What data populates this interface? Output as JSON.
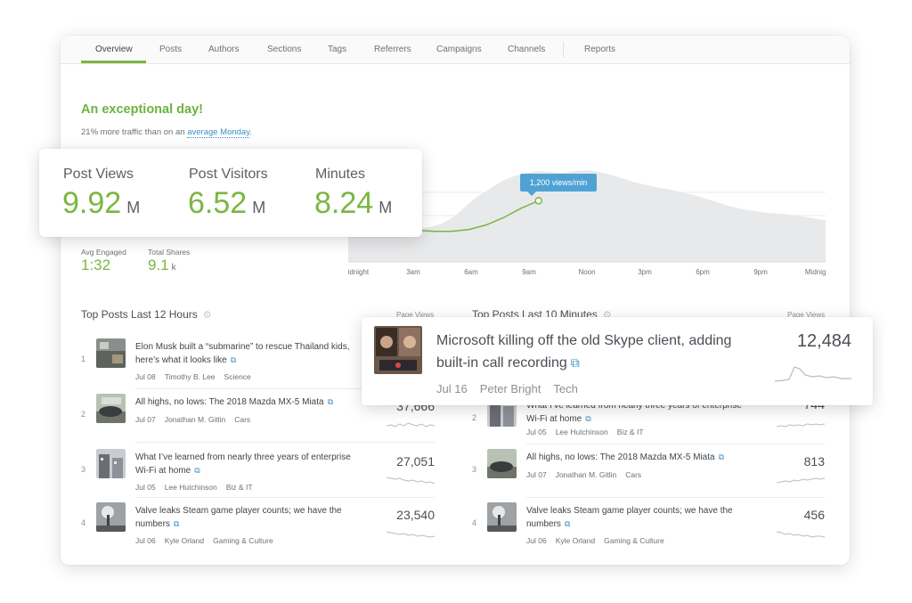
{
  "tabs": [
    {
      "label": "Overview",
      "active": true
    },
    {
      "label": "Posts"
    },
    {
      "label": "Authors"
    },
    {
      "label": "Sections"
    },
    {
      "label": "Tags"
    },
    {
      "label": "Referrers"
    },
    {
      "label": "Campaigns"
    },
    {
      "label": "Channels"
    },
    {
      "label": "Reports"
    }
  ],
  "headline": "An exceptional day!",
  "subline": {
    "prefix": "21% more traffic than on an ",
    "link": "average Monday",
    "suffix": "."
  },
  "big_stats": [
    {
      "label": "Post Views",
      "value": "9.92",
      "unit": "M"
    },
    {
      "label": "Post Visitors",
      "value": "6.52",
      "unit": "M"
    },
    {
      "label": "Minutes",
      "value": "8.24",
      "unit": "M"
    }
  ],
  "small_stats": [
    {
      "label": "Avg Engaged",
      "value": "1:32",
      "unit": ""
    },
    {
      "label": "Total Shares",
      "value": "9.1",
      "unit": "k"
    }
  ],
  "chart_data": {
    "type": "area",
    "x_ticks": [
      "Midnight",
      "3am",
      "6am",
      "9am",
      "Noon",
      "3pm",
      "6pm",
      "9pm",
      "Midnight"
    ],
    "tooltip": "1,200 views/min",
    "series": [
      {
        "values": [
          0.3,
          0.32,
          0.34,
          0.36,
          0.38,
          0.37,
          0.36,
          0.38,
          0.42,
          0.5,
          0.62,
          0.72,
          0.8,
          0.88,
          0.93,
          0.96,
          0.98,
          0.97,
          0.96,
          0.98,
          0.99,
          0.97,
          0.94,
          0.9,
          0.86,
          0.83,
          0.8,
          0.78,
          0.75,
          0.72,
          0.68,
          0.64,
          0.6,
          0.57,
          0.55,
          0.53,
          0.52,
          0.51,
          0.49,
          0.47,
          0.45
        ]
      },
      {
        "values": [
          0.38,
          0.37,
          0.36,
          0.35,
          0.34,
          0.33,
          0.33,
          0.35,
          0.4,
          0.48,
          0.58,
          0.66
        ]
      }
    ]
  },
  "top_posts_12h": {
    "title": "Top Posts Last 12 Hours",
    "column": "Page Views",
    "rows": [
      {
        "rank": "1",
        "title": "Elon Musk built a “submarine” to rescue Thailand kids, here’s what it looks like",
        "date": "Jul 08",
        "author": "Timothy B. Lee",
        "section": "Science",
        "views": ""
      },
      {
        "rank": "2",
        "title": "All highs, no lows: The 2018 Mazda MX-5 Miata",
        "date": "Jul 07",
        "author": "Jonathan M. Gitlin",
        "section": "Cars",
        "views": "37,666"
      },
      {
        "rank": "3",
        "title": "What I’ve learned from nearly three years of enterprise Wi-Fi at home",
        "date": "Jul 05",
        "author": "Lee Hutchinson",
        "section": "Biz & IT",
        "views": "27,051"
      },
      {
        "rank": "4",
        "title": "Valve leaks Steam game player counts; we have the numbers",
        "date": "Jul 06",
        "author": "Kyle Orland",
        "section": "Gaming & Culture",
        "views": "23,540"
      }
    ]
  },
  "top_posts_10m": {
    "title": "Top Posts Last 10 Minutes",
    "column": "Page Views",
    "rows": [
      {
        "rank": "2",
        "title": "What I’ve learned from nearly three years of enterprise Wi-Fi at home",
        "date": "Jul 05",
        "author": "Lee Hutchinson",
        "section": "Biz & IT",
        "views": "744"
      },
      {
        "rank": "3",
        "title": "All highs, no lows: The 2018 Mazda MX-5 Miata",
        "date": "Jul 07",
        "author": "Jonathan M. Gitlin",
        "section": "Cars",
        "views": "813"
      },
      {
        "rank": "4",
        "title": "Valve leaks Steam game player counts; we have the numbers",
        "date": "Jul 06",
        "author": "Kyle Orland",
        "section": "Gaming & Culture",
        "views": "456"
      }
    ]
  },
  "featured_post": {
    "title": "Microsoft killing off the old Skype client, adding built-in call recording",
    "date": "Jul 16",
    "author": "Peter Bright",
    "section": "Tech",
    "views": "12,484"
  },
  "colors": {
    "accent_green": "#7ab642",
    "link_blue": "#3b8fc4",
    "chart_fill": "#e8e9ea"
  },
  "icons": {
    "external": "external-link-icon",
    "settings": "gear-icon"
  }
}
